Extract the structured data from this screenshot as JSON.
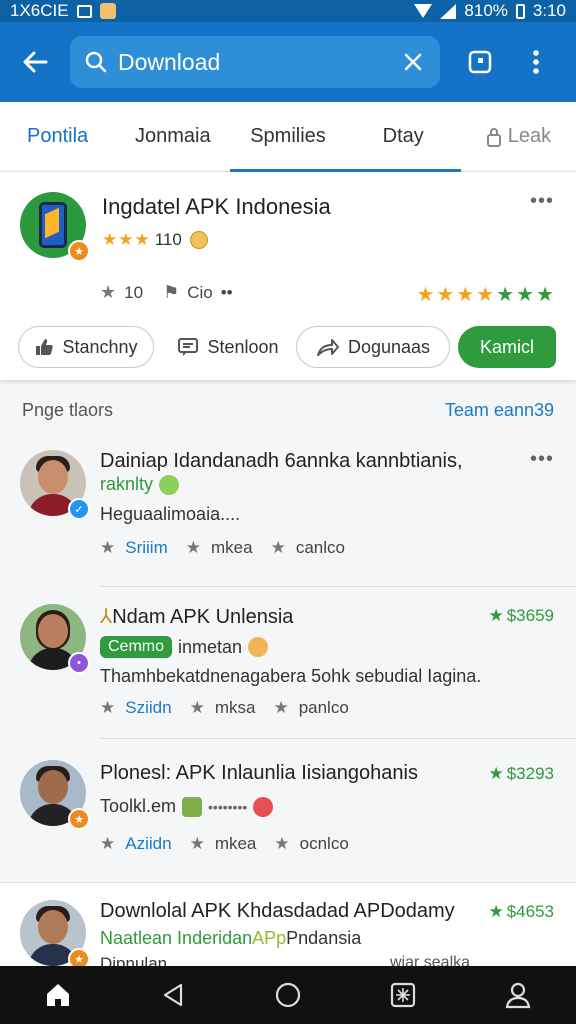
{
  "status_bar": {
    "left_text": "1X6CIE",
    "battery_percent": "810%",
    "time": "3:10"
  },
  "search": {
    "value": "Download",
    "placeholder": "Download"
  },
  "tabs": [
    {
      "label": "Pontila",
      "active": true
    },
    {
      "label": "Jonmaia"
    },
    {
      "label": "Spmilies"
    },
    {
      "label": "Dtay"
    },
    {
      "label": "Leak"
    }
  ],
  "featured": {
    "title": "Ingdatel APK Indonesia",
    "rating_text": "110",
    "stars": "★★★",
    "meta_count": "10",
    "meta_label": "Cio",
    "meta_more": "••",
    "buttons": {
      "stanchny": "Stanchny",
      "stenloon": "Stenloon",
      "dogunaas": "Dogunaas",
      "kamicl": "Kamicl"
    },
    "right_stars_orange": "★★★★",
    "right_stars_green": "★★★"
  },
  "section": {
    "title": "Pnge tlaors",
    "link": "Team eann39"
  },
  "items": [
    {
      "title": "Dainiap Idandanadh 6annka kannbtianis,",
      "sub_green": "raknlty",
      "desc": "Heguaalimoaia....",
      "meta": [
        "Sriiim",
        "mkea",
        "canlco"
      ]
    },
    {
      "title": "Ndam APK Unlensia",
      "price": "$3659",
      "pill": "Cemmo",
      "sub_text": "inmetan",
      "desc": "Thamhbekatdnenagabera 5ohk sebudial Iagina.",
      "meta": [
        "Sziidn",
        "mksa",
        "panlco"
      ]
    },
    {
      "title": "Plonesl: APK Inlaunlia Iisiangohanis",
      "price": "$3293",
      "sub_text": "Toolkl.em",
      "sub_dots": "••••••••",
      "meta": [
        "Aziidn",
        "mkea",
        "ocnlco"
      ]
    },
    {
      "title": "Downlolal APK Khdasdadad APDodamy",
      "price": "$4653",
      "sub_a": "Naatlean Inderidan ",
      "sub_b": "APp",
      "sub_c": " Pndansia",
      "desc": "Dipnulan",
      "meta_tail": "wiar sealka"
    }
  ],
  "colors": {
    "app_bar": "#1473c6",
    "accent_green": "#2e9b3d",
    "star_orange": "#f2a21c",
    "link_blue": "#1a7ac8"
  }
}
